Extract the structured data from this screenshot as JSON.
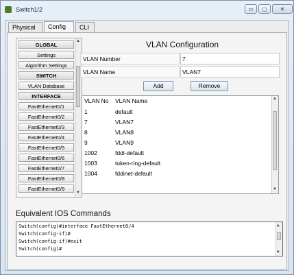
{
  "window": {
    "title": "Switch1/2"
  },
  "titlebar": {
    "minimize": "▭",
    "maximize": "▢",
    "close": "✕"
  },
  "tabs": {
    "physical": "Physical",
    "config": "Config",
    "cli": "CLI"
  },
  "sidebar": {
    "items": [
      {
        "label": "GLOBAL",
        "header": true
      },
      {
        "label": "Settings"
      },
      {
        "label": "Algorithm Settings"
      },
      {
        "label": "SWITCH",
        "header": true
      },
      {
        "label": "VLAN Database"
      },
      {
        "label": "INTERFACE",
        "header": true
      },
      {
        "label": "FastEthernet0/1"
      },
      {
        "label": "FastEthernet0/2"
      },
      {
        "label": "FastEthernet0/3"
      },
      {
        "label": "FastEthernet0/4"
      },
      {
        "label": "FastEthernet0/5"
      },
      {
        "label": "FastEthernet0/6"
      },
      {
        "label": "FastEthernet0/7"
      },
      {
        "label": "FastEthernet0/8"
      },
      {
        "label": "FastEthernet0/9"
      }
    ],
    "scroll_up": "▲",
    "scroll_down": "▼"
  },
  "vlan_config": {
    "title": "VLAN Configuration",
    "number_label": "VLAN Number",
    "number_value": "7",
    "name_label": "VLAN Name",
    "name_value": "VLAN7",
    "add_label": "Add",
    "remove_label": "Remove"
  },
  "vlan_table": {
    "columns": [
      "VLAN No",
      "VLAN Name"
    ],
    "rows": [
      {
        "no": "1",
        "name": "default"
      },
      {
        "no": "7",
        "name": "VLAN7"
      },
      {
        "no": "8",
        "name": "VLAN8"
      },
      {
        "no": "9",
        "name": "VLAN9"
      },
      {
        "no": "1002",
        "name": "fddi-default"
      },
      {
        "no": "1003",
        "name": "token-ring-default"
      },
      {
        "no": "1004",
        "name": "fddinet-default"
      }
    ],
    "scroll_up": "▲",
    "scroll_down": "▼"
  },
  "ios": {
    "title": "Equivalent IOS Commands",
    "lines": [
      "Switch(config)#interface FastEthernet0/4",
      "Switch(config-if)#",
      "Switch(config-if)#exit",
      "Switch(config)#"
    ],
    "scroll_up": "▲",
    "scroll_down": "▼"
  }
}
